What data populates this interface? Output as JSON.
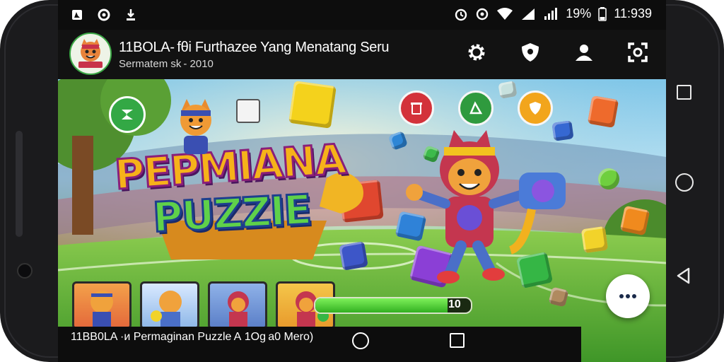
{
  "statusbar": {
    "battery": "19%",
    "time": "11:939"
  },
  "app": {
    "title": "11BOLA- fθi Furthazee Yang Menatang Seru",
    "subtitle": "Sermatem sk - 2010"
  },
  "game": {
    "logo_line1": "PEPMIANA",
    "logo_line2": "PUZZIE",
    "progress_value": "10",
    "progress_fraction": 0.85
  },
  "caption": {
    "text": "11BB0LA ·и Permaginan Puzzle А 1Оg a0 Mero)"
  },
  "colors": {
    "accent_green": "#3bb44a",
    "app_bar": "#121212"
  }
}
